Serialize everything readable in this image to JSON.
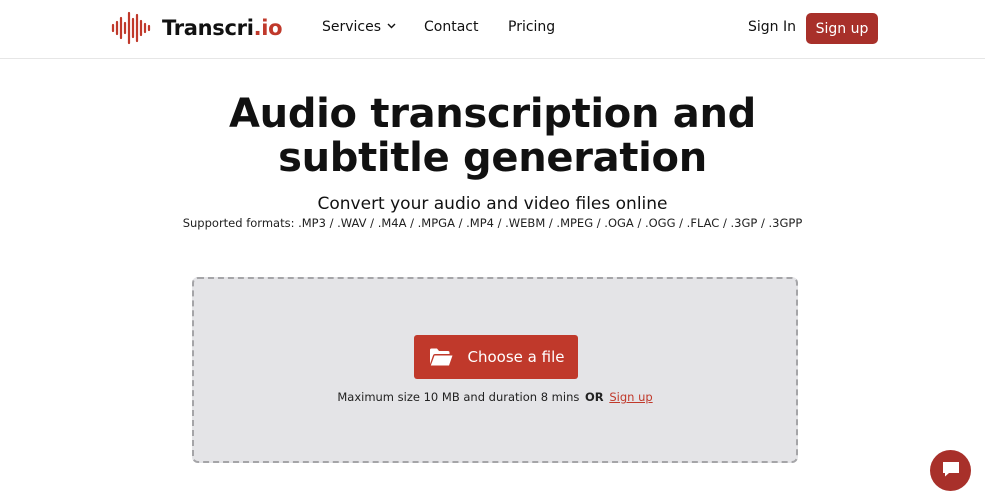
{
  "header": {
    "logo": {
      "text_main": "Transcri",
      "text_accent": ".io",
      "icon": "waveform-icon"
    },
    "nav": {
      "services": "Services",
      "contact": "Contact",
      "pricing": "Pricing"
    },
    "sign_in": "Sign In",
    "sign_up": "Sign up"
  },
  "hero": {
    "title_line1": "Audio transcription and",
    "title_line2": "subtitle generation",
    "subtitle": "Convert your audio and video files online",
    "formats": "Supported formats: .MP3 / .WAV / .M4A / .MPGA / .MP4 / .WEBM / .MPEG / .OGA / .OGG / .FLAC / .3GP / .3GPP"
  },
  "upload": {
    "button_label": "Choose a file",
    "button_icon": "folder-open-icon",
    "limits_text": "Maximum size 10 MB and duration 8 mins",
    "or_text": "OR",
    "signup_link": "Sign up"
  },
  "chat": {
    "icon": "chat-icon"
  },
  "colors": {
    "brand": "#a8302a",
    "accent": "#c0392b",
    "dropzone_bg": "#e4e4e7"
  }
}
